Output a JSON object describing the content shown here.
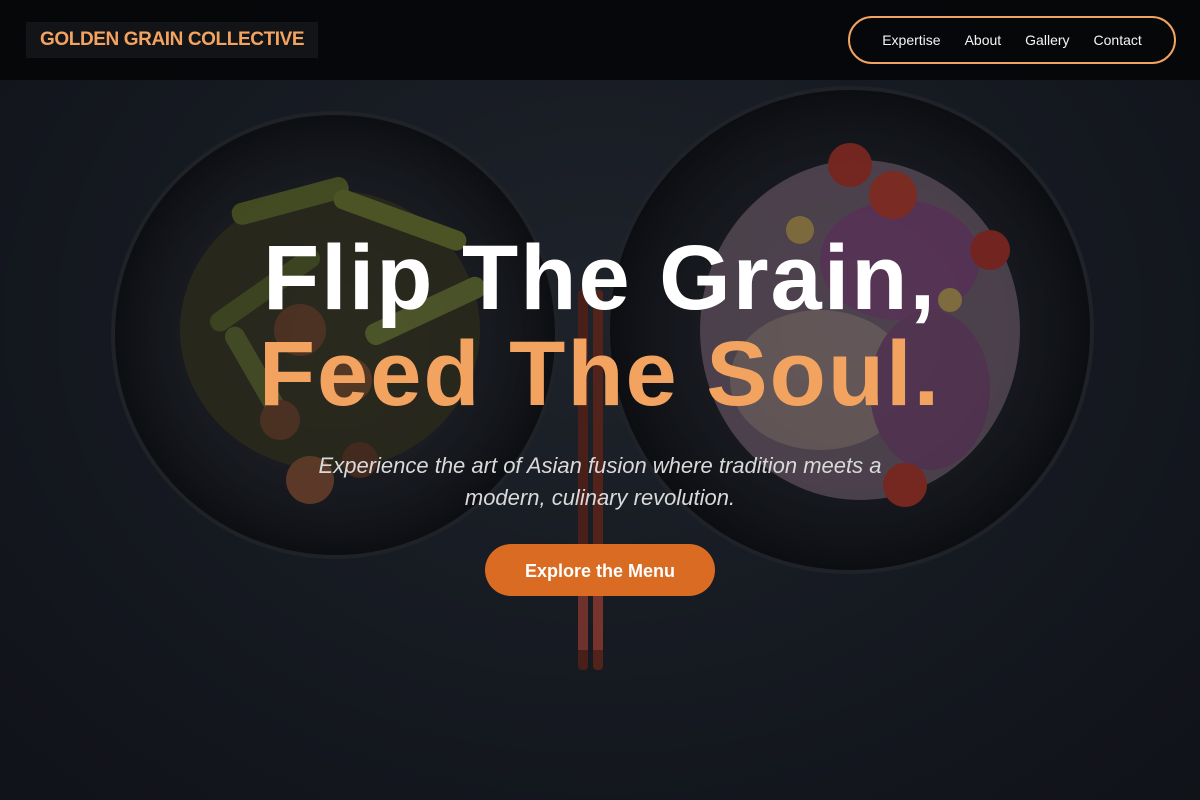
{
  "brand": {
    "name": "GOLDEN GRAIN COLLECTIVE"
  },
  "nav": {
    "items": [
      {
        "label": "Expertise"
      },
      {
        "label": "About"
      },
      {
        "label": "Gallery"
      },
      {
        "label": "Contact"
      }
    ]
  },
  "hero": {
    "headline_line1": "Flip The Grain,",
    "headline_line2": "Feed The Soul.",
    "subtitle": "Experience the art of Asian fusion where tradition meets a modern, culinary revolution.",
    "cta_label": "Explore the Menu",
    "background_image": "two bowls of food with chopsticks"
  },
  "colors": {
    "accent": "#f2a360",
    "button": "#d96b22",
    "nav_bg": "#050609"
  }
}
